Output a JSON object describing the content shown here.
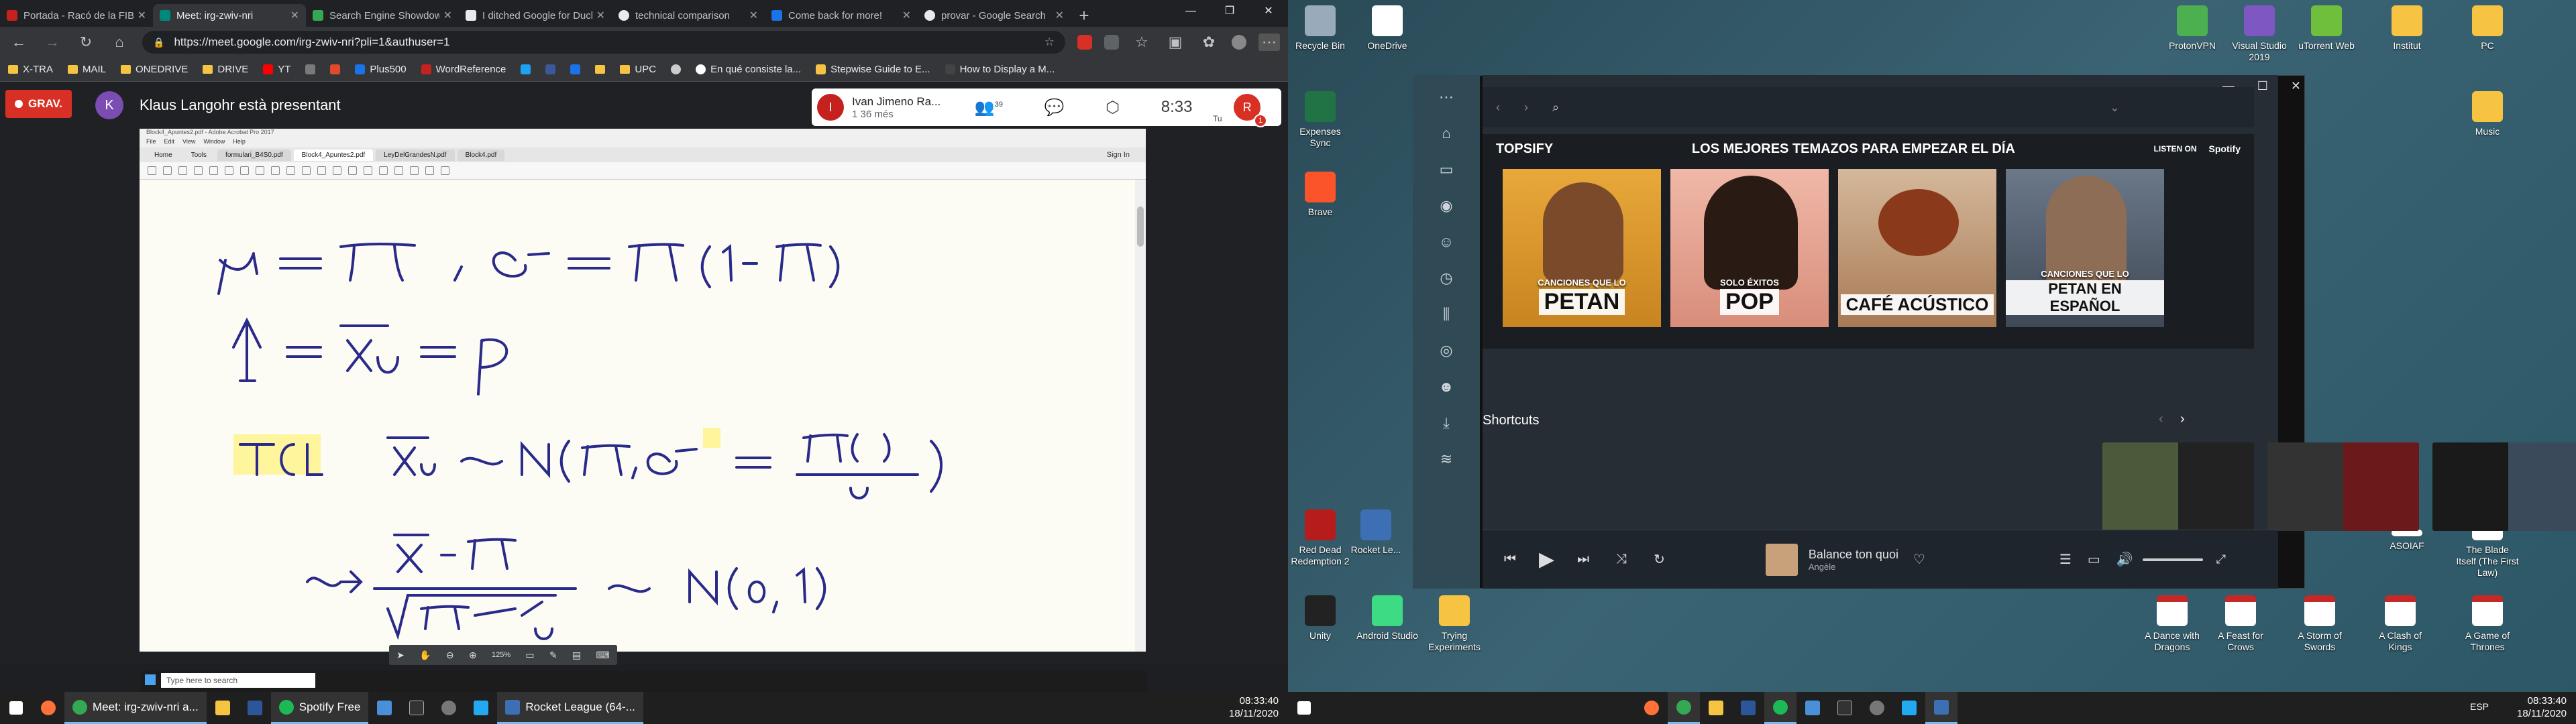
{
  "browser": {
    "tabs": [
      {
        "title": "Portada - Racó de la FIB",
        "color": "#c5221f"
      },
      {
        "title": "Meet: irg-zwiv-nri",
        "color": "#00897b"
      },
      {
        "title": "Search Engine Showdown",
        "color": "#34a853"
      },
      {
        "title": "I ditched Google for DuckDuckGo",
        "color": "#e8eaed"
      },
      {
        "title": "technical comparison",
        "color": "#e8eaed"
      },
      {
        "title": "Come back for more!",
        "color": "#1a73e8"
      },
      {
        "title": "provar - Google Search",
        "color": "#e8eaed"
      }
    ],
    "url": "https://meet.google.com/irg-zwiv-nri?pli=1&authuser=1",
    "bookmarks": [
      "X-TRA",
      "MAIL",
      "ONEDRIVE",
      "DRIVE",
      "YT",
      "Plus500",
      "WordReference",
      "UPC",
      "En qué consiste la...",
      "Stepwise Guide to E...",
      "How to Display a M..."
    ]
  },
  "meet": {
    "recording_label": "GRAV.",
    "presenter_initial": "K",
    "presenter_text": "Klaus Langohr està presentant",
    "caller_initial": "I",
    "caller_name": "Ivan Jimeno Ra...",
    "caller_sub": "1 36 més",
    "participants_count": "39",
    "time": "8:33",
    "self_initial": "R",
    "self_label": "Tu",
    "badge": "1"
  },
  "shared_screen": {
    "app_title": "Block4_Apuntes2.pdf - Adobe Acrobat Pro 2017",
    "menu": [
      "File",
      "Edit",
      "View",
      "Window",
      "Help"
    ],
    "nav": [
      "Home",
      "Tools"
    ],
    "tabs": [
      "formulari_B4S0.pdf",
      "Block4_Apuntes2.pdf",
      "LeyDelGrandesN.pdf",
      "Block4.pdf"
    ],
    "sign_in": "Sign In",
    "zoom": "125%",
    "remote_search": "Type here to search"
  },
  "taskbar_left": {
    "items": [
      "Meet: irg-zwiv-nri a...",
      "Spotify Free",
      "Rocket League (64-..."
    ],
    "time": "08:33:40",
    "date": "18/11/2020"
  },
  "desktop": {
    "icons_left": [
      "Recycle Bin",
      "OneDrive",
      "Expenses Sync",
      "Brave",
      "Red Dead Redemption 2",
      "Rocket Le...",
      "Unity",
      "Android Studio",
      "Trying Experiments"
    ],
    "icons_right": [
      "ProtonVPN",
      "Visual Studio 2019",
      "uTorrent Web",
      "Institut",
      "PC",
      "Music",
      "ASOIAF",
      "The Blade Itself (The First Law)",
      "A Dance with Dragons",
      "A Feast for Crows",
      "A Storm of Swords",
      "A Clash of Kings",
      "A Game of Thrones"
    ]
  },
  "spotify": {
    "banner_brand": "TOPSIFY",
    "banner_title": "LOS MEJORES TEMAZOS PARA EMPEZAR EL DÍA",
    "listen_on": "LISTEN ON",
    "spotify_label": "Spotify",
    "playlists": [
      {
        "small": "CANCIONES QUE LO",
        "big": "PETAN",
        "color": "#e0a030"
      },
      {
        "small": "SOLO ÉXITOS",
        "big": "POP",
        "color": "#e8a090"
      },
      {
        "small": "",
        "big": "CAFÉ ACÚSTICO",
        "color": "#c8a080"
      },
      {
        "small": "CANCIONES QUE LO",
        "big": "PETAN EN ESPAÑOL",
        "color": "#5a6a7a"
      }
    ],
    "shortcuts_title": "Shortcuts",
    "track_title": "Balance ton quoi",
    "track_artist": "Angèle"
  },
  "taskbar_right": {
    "lang": "ESP",
    "time": "08:33:40",
    "date": "18/11/2020"
  }
}
